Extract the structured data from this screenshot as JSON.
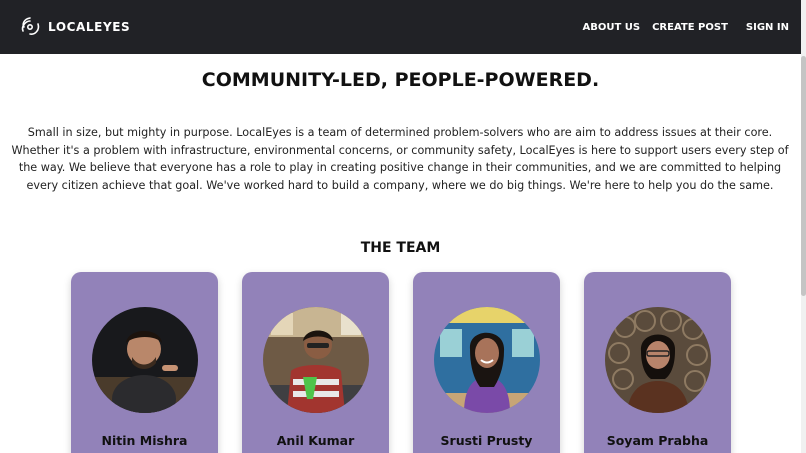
{
  "header": {
    "brand": "LOCALEYES",
    "nav": {
      "about": "ABOUT US",
      "create": "CREATE POST",
      "signin": "SIGN IN"
    }
  },
  "main": {
    "headline": "COMMUNITY-LED, PEOPLE-POWERED.",
    "intro": "Small in size, but mighty in purpose. LocalEyes is a team of determined problem-solvers who are aim to address issues at their core. Whether it's a problem with infrastructure, environmental concerns, or community safety, LocalEyes is here to support users every step of the way. We believe that everyone has a role to play in creating positive change in their communities, and we are committed to helping every citizen achieve that goal. We've worked hard to build a company, where we do big things. We're here to help you do the same.",
    "team_title": "THE TEAM",
    "team": [
      {
        "name": "Nitin Mishra"
      },
      {
        "name": "Anil Kumar"
      },
      {
        "name": "Srusti Prusty"
      },
      {
        "name": "Soyam Prabha"
      }
    ]
  },
  "colors": {
    "navbar": "#212226",
    "card": "#9282b9"
  }
}
